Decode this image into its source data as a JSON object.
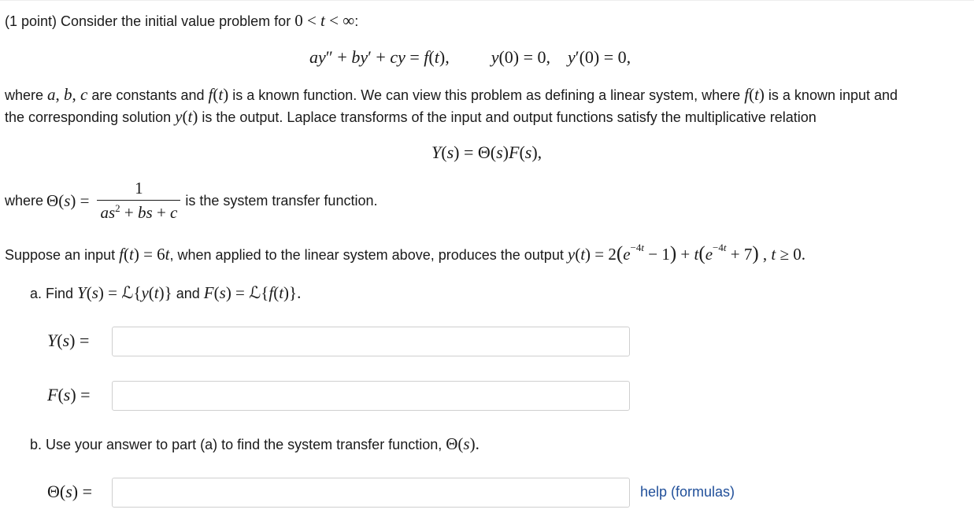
{
  "problem": {
    "intro": "(1 point) Consider the initial value problem for",
    "para1_a": "where",
    "para1_b": "are constants and",
    "para1_c": "is a known function. We can view this problem as defining a linear system, where",
    "para1_d": "is a known input and",
    "para2_a": "the corresponding solution",
    "para2_b": "is the output. Laplace transforms of the input and output functions satisfy the multiplicative relation",
    "where_label": "where",
    "transfer_suffix": "is the system transfer function.",
    "suppose_a": "Suppose an input",
    "suppose_b": ", when applied to the linear system above, produces the output",
    "part_a_prefix": "a. Find",
    "part_a_and": "and",
    "part_b": "b. Use your answer to part (a) to find the system transfer function,"
  },
  "answers": {
    "Y_value": "",
    "F_value": "",
    "Theta_value": ""
  },
  "help_link": "help (formulas)"
}
